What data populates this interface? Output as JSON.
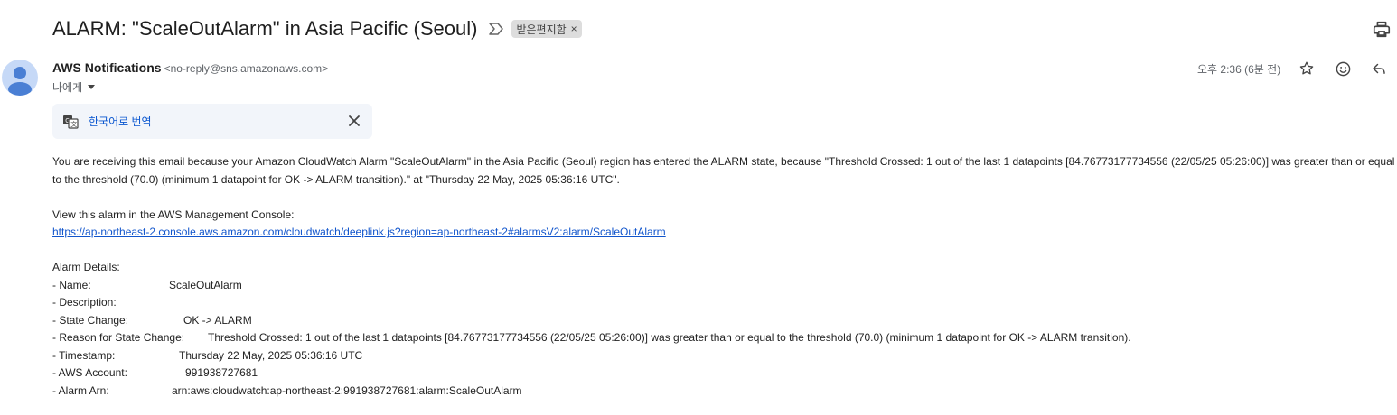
{
  "subject": "ALARM: \"ScaleOutAlarm\" in Asia Pacific (Seoul)",
  "label_chip": "받은편지함",
  "label_remove": "×",
  "sender": {
    "name": "AWS Notifications",
    "email": "<no-reply@sns.amazonaws.com>",
    "to": "나에게"
  },
  "time": "오후 2:36 (6분 전)",
  "icons": {
    "importance": "importance-marker-icon",
    "print": "print-icon",
    "star": "star-icon",
    "emoji": "emoji-reaction-icon",
    "reply": "reply-icon",
    "translate": "translate-icon",
    "close": "close-icon",
    "avatar": "avatar-person-icon"
  },
  "translate": {
    "label": "한국어로 번역"
  },
  "body": {
    "intro": "You are receiving this email because your Amazon CloudWatch Alarm \"ScaleOutAlarm\" in the Asia Pacific (Seoul) region has entered the ALARM state, because \"Threshold Crossed: 1 out of the last 1 datapoints [84.76773177734556 (22/05/25 05:26:00)] was greater than or equal to the threshold (70.0) (minimum 1 datapoint for OK -> ALARM transition).\" at \"Thursday 22 May, 2025 05:36:16 UTC\".",
    "console_label": "View this alarm in the AWS Management Console:",
    "console_link": "https://ap-northeast-2.console.aws.amazon.com/cloudwatch/deeplink.js?region=ap-northeast-2#alarmsV2:alarm/ScaleOutAlarm",
    "details_heading": "Alarm Details:",
    "details": [
      {
        "key": "- Name:",
        "value": "ScaleOutAlarm"
      },
      {
        "key": "- Description:",
        "value": ""
      },
      {
        "key": "- State Change:",
        "value": "OK -> ALARM"
      },
      {
        "key": "- Reason for State Change:",
        "value": "Threshold Crossed: 1 out of the last 1 datapoints [84.76773177734556 (22/05/25 05:26:00)] was greater than or equal to the threshold (70.0) (minimum 1 datapoint for OK -> ALARM transition)."
      },
      {
        "key": "- Timestamp:",
        "value": "Thursday 22 May, 2025 05:36:16 UTC"
      },
      {
        "key": "- AWS Account:",
        "value": "991938727681"
      },
      {
        "key": "- Alarm Arn:",
        "value": "arn:aws:cloudwatch:ap-northeast-2:991938727681:alarm:ScaleOutAlarm"
      }
    ]
  },
  "colors": {
    "link": "#1155cc",
    "translate_link": "#0b57d0",
    "translate_bg": "#f2f5fa",
    "avatar_bg": "#c6d9f7",
    "avatar_fg": "#4a7fd4"
  }
}
